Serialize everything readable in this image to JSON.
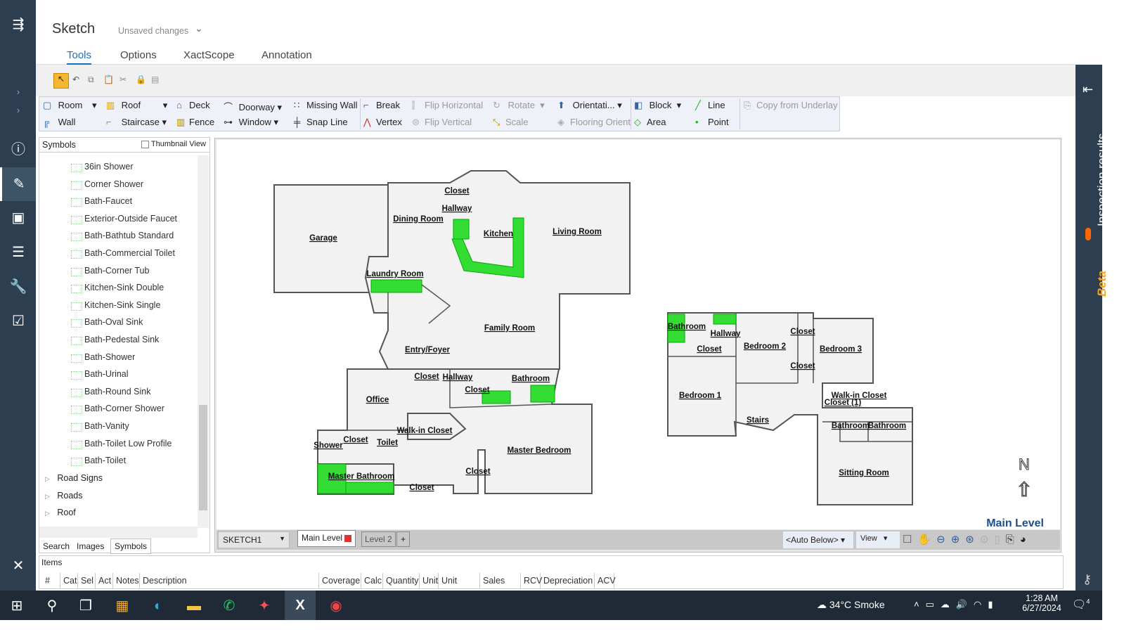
{
  "app": {
    "title": "Sketch",
    "status": "Unsaved changes"
  },
  "tabs": [
    "Tools",
    "Options",
    "XactScope",
    "Annotation"
  ],
  "ribbon": {
    "room": "Room",
    "wall": "Wall",
    "roof": "Roof",
    "staircase": "Staircase",
    "deck": "Deck",
    "fence": "Fence",
    "doorway": "Doorway",
    "window": "Window",
    "missing_wall": "Missing Wall",
    "snap_line": "Snap Line",
    "break": "Break",
    "vertex": "Vertex",
    "flip_h": "Flip Horizontal",
    "flip_v": "Flip Vertical",
    "rotate": "Rotate",
    "scale": "Scale",
    "orientation": "Orientati...",
    "flooring": "Flooring Orient",
    "block": "Block",
    "area": "Area",
    "line": "Line",
    "point": "Point",
    "copy_underlay": "Copy from Underlay"
  },
  "symbols": {
    "title": "Symbols",
    "thumbnail": "Thumbnail View",
    "items": [
      "36in Shower",
      "Corner Shower",
      "Bath-Faucet",
      "Exterior-Outside Faucet",
      "Bath-Bathtub Standard",
      "Bath-Commercial Toilet",
      "Bath-Corner Tub",
      "Kitchen-Sink Double",
      "Kitchen-Sink Single",
      "Bath-Oval Sink",
      "Bath-Pedestal Sink",
      "Bath-Shower",
      "Bath-Urinal",
      "Bath-Round Sink",
      "Bath-Corner Shower",
      "Bath-Vanity",
      "Bath-Toilet Low Profile",
      "Bath-Toilet"
    ],
    "groups": [
      "Road Signs",
      "Roads",
      "Roof"
    ],
    "bottom_tabs": [
      "Search",
      "Images",
      "Symbols"
    ]
  },
  "plan": {
    "rooms": [
      "Garage",
      "Closet",
      "Hallway",
      "Dining Room",
      "Kitchen",
      "Living Room",
      "Laundry Room",
      "Family Room",
      "Entry/Foyer",
      "Closet",
      "Hallway",
      "Closet",
      "Bathroom",
      "Office",
      "Walk-in Closet",
      "Shower",
      "Closet",
      "Toilet",
      "Master Bedroom",
      "Closet",
      "Master Bathroom",
      "Closet",
      "Bathroom",
      "Hallway",
      "Closet",
      "Bedroom 2",
      "Closet",
      "Bedroom 3",
      "Closet",
      "Bedroom 1",
      "Walk-in Closet",
      "Closet (1)",
      "Stairs",
      "Bathroom",
      "Bathroom",
      "Sitting Room"
    ],
    "north": "N",
    "level_label": "Main Level"
  },
  "canvas_bar": {
    "sketch": "SKETCH1",
    "levels": [
      "Main Level",
      "Level 2"
    ],
    "add": "+",
    "auto_below": "<Auto Below>",
    "view": "View"
  },
  "items": {
    "title": "Items",
    "columns": [
      "#",
      "Cat",
      "Sel",
      "Act",
      "Notes",
      "Description",
      "Coverage",
      "Calc",
      "Quantity",
      "Unit",
      "Unit Price",
      "Sales Tax",
      "RCV",
      "Depreciation",
      "ACV"
    ]
  },
  "right": {
    "label": "Inspection results",
    "beta": "Beta"
  },
  "taskbar": {
    "weather": "34°C  Smoke",
    "time": "1:28 AM",
    "date": "6/27/2024",
    "notif": "4"
  },
  "colors": {
    "sidebar": "#2c3e50",
    "fixture": "#22cc22",
    "accent": "#1f4e8c"
  }
}
